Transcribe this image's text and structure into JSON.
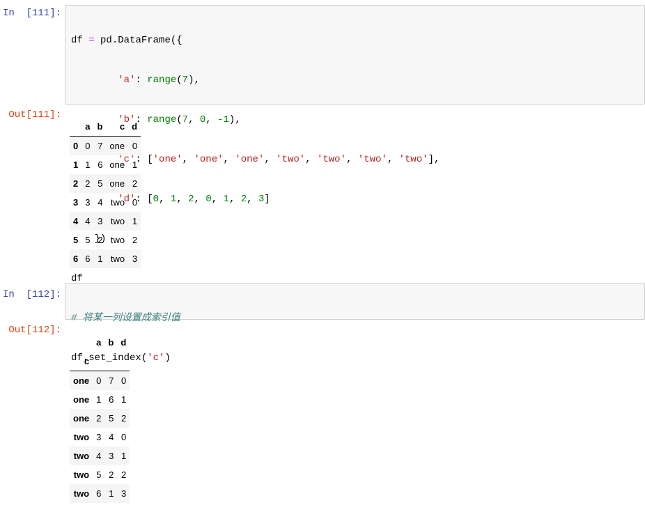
{
  "cell1": {
    "in_prompt": "In  [111]:",
    "out_prompt": "Out[111]:",
    "code": {
      "l1": {
        "a": "df",
        "b": " = ",
        "c": "pd.DataFrame({"
      },
      "l2": {
        "ind": "        ",
        "k": "'a'",
        "p": ": ",
        "f": "range",
        "o": "(",
        "n": "7",
        "c": "),"
      },
      "l3": {
        "ind": "        ",
        "k": "'b'",
        "p": ": ",
        "f": "range",
        "o": "(",
        "n1": "7",
        "s1": ", ",
        "n2": "0",
        "s2": ", ",
        "n3": "-1",
        "c": "),"
      },
      "l4": {
        "ind": "        ",
        "k": "'c'",
        "p": ": [",
        "v": [
          "'one'",
          "'one'",
          "'one'",
          "'two'",
          "'two'",
          "'two'",
          "'two'"
        ],
        "sep": ", ",
        "c": "],"
      },
      "l5": {
        "ind": "        ",
        "k": "'d'",
        "p": ": [",
        "v": [
          "0",
          "1",
          "2",
          "0",
          "1",
          "2",
          "3"
        ],
        "sep": ", ",
        "c": "]"
      },
      "l6": "    })",
      "l7": "df"
    },
    "table": {
      "columns": [
        "a",
        "b",
        "c",
        "d"
      ],
      "rows": [
        {
          "index": "0",
          "cells": [
            "0",
            "7",
            "one",
            "0"
          ]
        },
        {
          "index": "1",
          "cells": [
            "1",
            "6",
            "one",
            "1"
          ]
        },
        {
          "index": "2",
          "cells": [
            "2",
            "5",
            "one",
            "2"
          ]
        },
        {
          "index": "3",
          "cells": [
            "3",
            "4",
            "two",
            "0"
          ]
        },
        {
          "index": "4",
          "cells": [
            "4",
            "3",
            "two",
            "1"
          ]
        },
        {
          "index": "5",
          "cells": [
            "5",
            "2",
            "two",
            "2"
          ]
        },
        {
          "index": "6",
          "cells": [
            "6",
            "1",
            "two",
            "3"
          ]
        }
      ]
    }
  },
  "cell2": {
    "in_prompt": "In  [112]:",
    "out_prompt": "Out[112]:",
    "code": {
      "comment": "# 将某一列设置成索引值",
      "l2": {
        "a": "df.set_index(",
        "s": "'c'",
        "c": ")"
      }
    },
    "table": {
      "columns": [
        "a",
        "b",
        "d"
      ],
      "index_name": "c",
      "rows": [
        {
          "index": "one",
          "cells": [
            "0",
            "7",
            "0"
          ]
        },
        {
          "index": "one",
          "cells": [
            "1",
            "6",
            "1"
          ]
        },
        {
          "index": "one",
          "cells": [
            "2",
            "5",
            "2"
          ]
        },
        {
          "index": "two",
          "cells": [
            "3",
            "4",
            "0"
          ]
        },
        {
          "index": "two",
          "cells": [
            "4",
            "3",
            "1"
          ]
        },
        {
          "index": "two",
          "cells": [
            "5",
            "2",
            "2"
          ]
        },
        {
          "index": "two",
          "cells": [
            "6",
            "1",
            "3"
          ]
        }
      ]
    }
  }
}
